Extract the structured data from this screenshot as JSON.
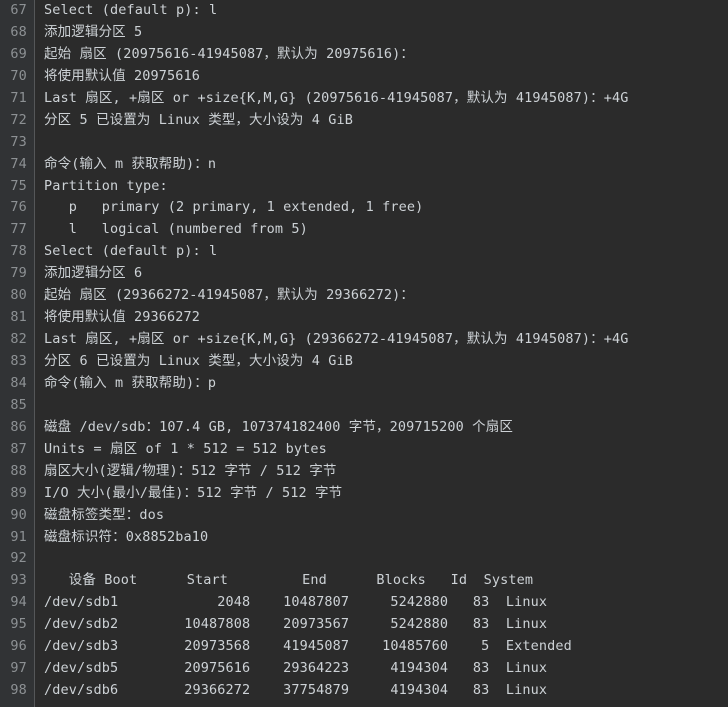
{
  "terminal": {
    "title": "fdisk partition session output",
    "colors": {
      "background": "#2b2b2b",
      "gutter_background": "#313335",
      "gutter_rule": "#555759",
      "line_number": "#8d9194",
      "text": "#cdd2d6"
    },
    "first_line_number": 67,
    "last_line_number": 98,
    "lines": [
      {
        "number": "67",
        "text": "Select (default p): l"
      },
      {
        "number": "68",
        "text": "添加逻辑分区 5"
      },
      {
        "number": "69",
        "text": "起始 扇区 (20975616-41945087，默认为 20975616)："
      },
      {
        "number": "70",
        "text": "将使用默认值 20975616"
      },
      {
        "number": "71",
        "text": "Last 扇区, +扇区 or +size{K,M,G} (20975616-41945087，默认为 41945087)：+4G"
      },
      {
        "number": "72",
        "text": "分区 5 已设置为 Linux 类型，大小设为 4 GiB"
      },
      {
        "number": "73",
        "text": ""
      },
      {
        "number": "74",
        "text": "命令(输入 m 获取帮助)：n"
      },
      {
        "number": "75",
        "text": "Partition type:"
      },
      {
        "number": "76",
        "text": "   p   primary (2 primary, 1 extended, 1 free)"
      },
      {
        "number": "77",
        "text": "   l   logical (numbered from 5)"
      },
      {
        "number": "78",
        "text": "Select (default p): l"
      },
      {
        "number": "79",
        "text": "添加逻辑分区 6"
      },
      {
        "number": "80",
        "text": "起始 扇区 (29366272-41945087，默认为 29366272)："
      },
      {
        "number": "81",
        "text": "将使用默认值 29366272"
      },
      {
        "number": "82",
        "text": "Last 扇区, +扇区 or +size{K,M,G} (29366272-41945087，默认为 41945087)：+4G"
      },
      {
        "number": "83",
        "text": "分区 6 已设置为 Linux 类型，大小设为 4 GiB"
      },
      {
        "number": "84",
        "text": "命令(输入 m 获取帮助)：p"
      },
      {
        "number": "85",
        "text": ""
      },
      {
        "number": "86",
        "text": "磁盘 /dev/sdb：107.4 GB, 107374182400 字节，209715200 个扇区"
      },
      {
        "number": "87",
        "text": "Units = 扇区 of 1 * 512 = 512 bytes"
      },
      {
        "number": "88",
        "text": "扇区大小(逻辑/物理)：512 字节 / 512 字节"
      },
      {
        "number": "89",
        "text": "I/O 大小(最小/最佳)：512 字节 / 512 字节"
      },
      {
        "number": "90",
        "text": "磁盘标签类型：dos"
      },
      {
        "number": "91",
        "text": "磁盘标识符：0x8852ba10"
      },
      {
        "number": "92",
        "text": ""
      },
      {
        "number": "93",
        "text": "   设备 Boot      Start         End      Blocks   Id  System"
      },
      {
        "number": "94",
        "text": "/dev/sdb1            2048    10487807     5242880   83  Linux"
      },
      {
        "number": "95",
        "text": "/dev/sdb2        10487808    20973567     5242880   83  Linux"
      },
      {
        "number": "96",
        "text": "/dev/sdb3        20973568    41945087    10485760    5  Extended"
      },
      {
        "number": "97",
        "text": "/dev/sdb5        20975616    29364223     4194304   83  Linux"
      },
      {
        "number": "98",
        "text": "/dev/sdb6        29366272    37754879     4194304   83  Linux"
      }
    ],
    "partition_table": {
      "headers": [
        "设备",
        "Boot",
        "Start",
        "End",
        "Blocks",
        "Id",
        "System"
      ],
      "rows": [
        {
          "device": "/dev/sdb1",
          "boot": "",
          "start": "2048",
          "end": "10487807",
          "blocks": "5242880",
          "id": "83",
          "system": "Linux"
        },
        {
          "device": "/dev/sdb2",
          "boot": "",
          "start": "10487808",
          "end": "20973567",
          "blocks": "5242880",
          "id": "83",
          "system": "Linux"
        },
        {
          "device": "/dev/sdb3",
          "boot": "",
          "start": "20973568",
          "end": "41945087",
          "blocks": "10485760",
          "id": "5",
          "system": "Extended"
        },
        {
          "device": "/dev/sdb5",
          "boot": "",
          "start": "20975616",
          "end": "29364223",
          "blocks": "4194304",
          "id": "83",
          "system": "Linux"
        },
        {
          "device": "/dev/sdb6",
          "boot": "",
          "start": "29366272",
          "end": "37754879",
          "blocks": "4194304",
          "id": "83",
          "system": "Linux"
        }
      ]
    },
    "disk_info": {
      "disk": "/dev/sdb",
      "size": "107.4 GB",
      "bytes": "107374182400",
      "sectors": "209715200",
      "units": "扇区 of 1 * 512 = 512 bytes",
      "sector_size_logical": "512 字节",
      "sector_size_physical": "512 字节",
      "io_size_min": "512 字节",
      "io_size_optimal": "512 字节",
      "label_type": "dos",
      "identifier": "0x8852ba10"
    }
  }
}
